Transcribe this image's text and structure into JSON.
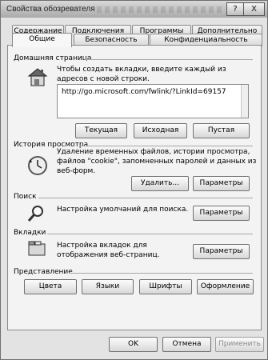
{
  "window": {
    "title": "Свойства обозревателя",
    "help": "?",
    "close": "X"
  },
  "tabs": {
    "row1": [
      "Содержание",
      "Подключения",
      "Программы",
      "Дополнительно"
    ],
    "row2": [
      "Общие",
      "Безопасность",
      "Конфиденциальность"
    ],
    "active": "Общие"
  },
  "home": {
    "title": "Домашняя страница",
    "desc": "Чтобы создать вкладки, введите каждый из адресов с новой строки.",
    "url": "http://go.microsoft.com/fwlink/?LinkId=69157",
    "btn_current": "Текущая",
    "btn_default": "Исходная",
    "btn_blank": "Пустая"
  },
  "history": {
    "title": "История просмотра",
    "desc": "Удаление временных файлов, истории просмотра, файлов \"cookie\", запомненных паролей и данных из веб-форм.",
    "btn_delete": "Удалить...",
    "btn_params": "Параметры"
  },
  "search": {
    "title": "Поиск",
    "desc": "Настройка умолчаний для поиска.",
    "btn_params": "Параметры"
  },
  "tabsSection": {
    "title": "Вкладки",
    "desc": "Настройка вкладок для отображения веб-страниц.",
    "btn_params": "Параметры"
  },
  "appearance": {
    "title": "Представление",
    "btn_colors": "Цвета",
    "btn_languages": "Языки",
    "btn_fonts": "Шрифты",
    "btn_design": "Оформление"
  },
  "footer": {
    "ok": "OK",
    "cancel": "Отмена",
    "apply": "Применить"
  },
  "icons": [
    "house-icon",
    "history-clock-icon",
    "magnifier-icon",
    "tabs-window-icon"
  ]
}
